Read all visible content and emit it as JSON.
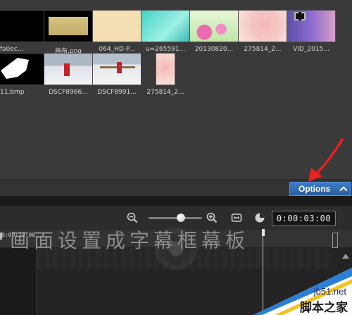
{
  "library": {
    "items": [
      {
        "label": "fa0ec..."
      },
      {
        "label": "画布.png"
      },
      {
        "label": "064_HD-P..."
      },
      {
        "label": "u=265591..."
      },
      {
        "label": "20130820..."
      },
      {
        "label": "275814_2..."
      },
      {
        "label": "VID_2015..."
      },
      {
        "label": "11.bmp"
      },
      {
        "label": "DSCF8966..."
      },
      {
        "label": "DSCF8991..."
      },
      {
        "label": "275814_2..."
      }
    ],
    "options_label": "Options"
  },
  "toolbar": {
    "icons": [
      "zoom-out-icon",
      "zoom-in-icon",
      "fit-icon",
      "clock-icon"
    ],
    "zoom_level": 0.55,
    "timecode": "0:00:03:00"
  },
  "timeline": {
    "ruler_time": "0:00:14:00"
  },
  "watermark": {
    "text": "画面设置成字幕框幕板"
  },
  "site_badge": {
    "domain": "jb51.net",
    "name": "脚本之家"
  },
  "colors": {
    "options_button": "#2f6bb0",
    "annotation_arrow": "#e8221f"
  }
}
